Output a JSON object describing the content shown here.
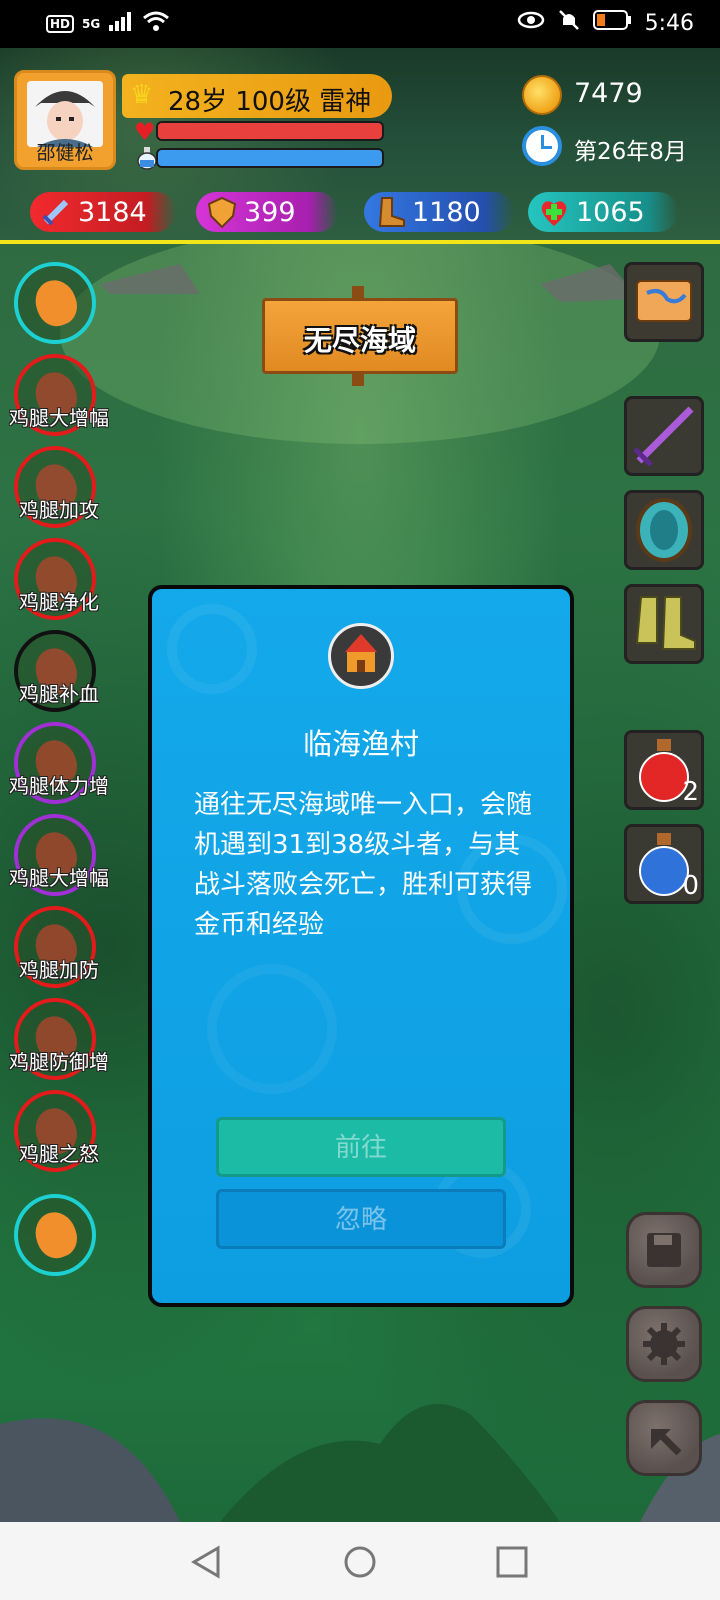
{
  "status_bar": {
    "left_badges": [
      "HD",
      "5G"
    ],
    "time": "5:46"
  },
  "player": {
    "name": "邵健松",
    "level_text": "28岁 100级 雷神",
    "hp_fraction": 1.0,
    "mp_fraction": 1.0,
    "gold": "7479",
    "date": "第26年8月"
  },
  "stats": [
    {
      "id": "attack",
      "value": "3184",
      "color": "#e8262b",
      "icon": "sword-icon"
    },
    {
      "id": "defense",
      "value": "399",
      "color": "#c72cc8",
      "icon": "shield-icon"
    },
    {
      "id": "speed",
      "value": "1180",
      "color": "#2c63d6",
      "icon": "boot-icon"
    },
    {
      "id": "health",
      "value": "1065",
      "color": "#22b7b2",
      "icon": "health-cross-icon"
    }
  ],
  "location_sign": "无尽海域",
  "left_buffs": [
    {
      "label": "",
      "ring_color": "#1dd1d3"
    },
    {
      "label": "鸡腿大增幅",
      "ring_color": "#e41b1b"
    },
    {
      "label": "鸡腿加攻",
      "ring_color": "#e41b1b"
    },
    {
      "label": "鸡腿净化",
      "ring_color": "#e41b1b"
    },
    {
      "label": "鸡腿补血",
      "ring_color": "#111111"
    },
    {
      "label": "鸡腿体力增",
      "ring_color": "#a12fd6"
    },
    {
      "label": "鸡腿大增幅",
      "ring_color": "#a12fd6"
    },
    {
      "label": "鸡腿加防",
      "ring_color": "#e41b1b"
    },
    {
      "label": "鸡腿防御增",
      "ring_color": "#e41b1b"
    },
    {
      "label": "鸡腿之怒",
      "ring_color": "#e41b1b"
    },
    {
      "label": "",
      "ring_color": "#1dd1d3"
    }
  ],
  "right_items": {
    "red_potion_count": "2",
    "blue_potion_count": "0"
  },
  "dialog": {
    "title": "临海渔村",
    "description": "通往无尽海域唯一入口，会随机遇到31到38级斗者，与其战斗落败会死亡，胜利可获得金币和经验",
    "go_label": "前往",
    "ignore_label": "忽略"
  },
  "colors": {
    "dialog_bg": "#14a9ea",
    "hud_divider": "#f2e51a"
  }
}
